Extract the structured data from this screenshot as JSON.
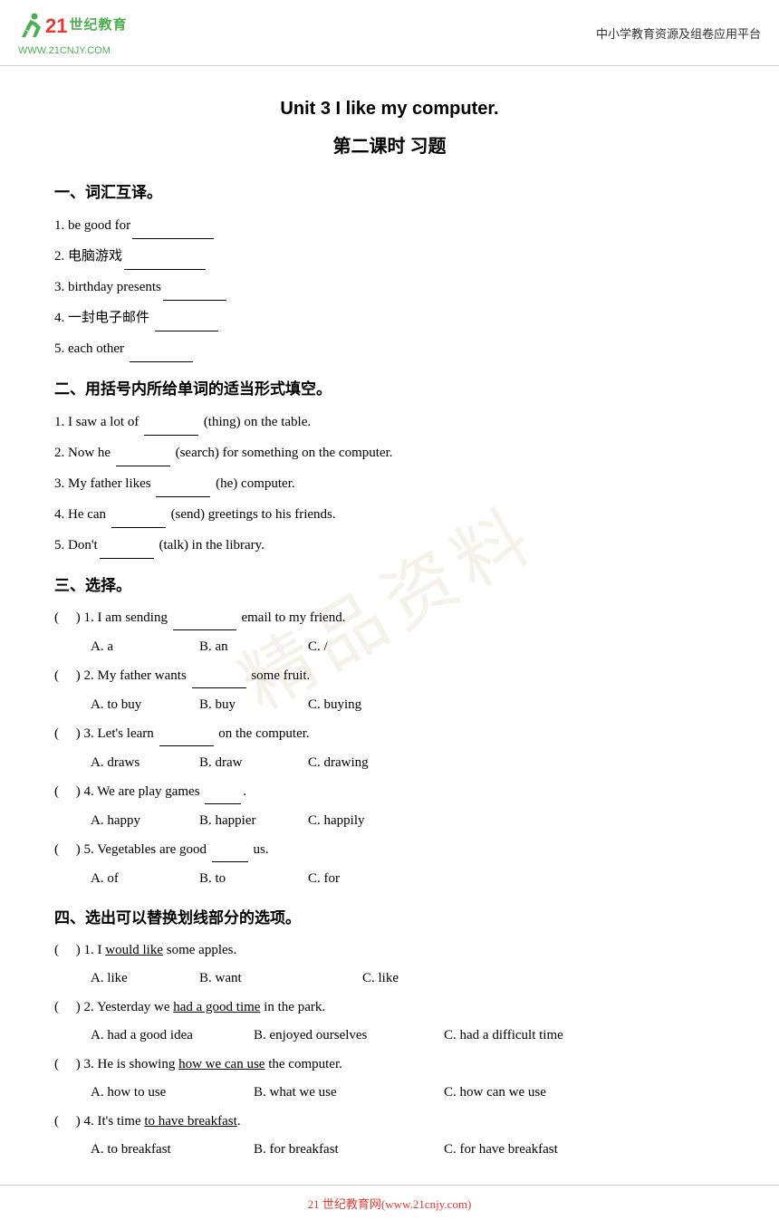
{
  "header": {
    "logo_text_21": "21",
    "logo_text_shiji": "世纪教育",
    "logo_url": "WWW.21CNJY.COM",
    "header_right": "中小学教育资源及组卷应用平台"
  },
  "main_title": "Unit 3 I like my computer.",
  "sub_title": "第二课时  习题",
  "sections": {
    "section1": {
      "title": "一、词汇互译。",
      "items": [
        "1. be good for",
        "2. 电脑游戏",
        "3. birthday presents",
        "4. 一封电子邮件",
        "5. each other"
      ]
    },
    "section2": {
      "title": "二、用括号内所给单词的适当形式填空。",
      "items": [
        "1. I saw a lot of ______ (thing) on the table.",
        "2. Now he ______ (search) for something on the computer.",
        "3. My father likes ______ (he) computer.",
        "4. He can ______ (send) greetings to his friends.",
        "5. Don't______ (talk) in the library."
      ]
    },
    "section3": {
      "title": "三、选择。",
      "items": [
        {
          "num": "1.",
          "text": "I am sending _______ email to my friend.",
          "options": [
            "A. a",
            "B. an",
            "C. /"
          ]
        },
        {
          "num": "2.",
          "text": "My father wants ______ some fruit.",
          "options": [
            "A. to buy",
            "B. buy",
            "C. buying"
          ]
        },
        {
          "num": "3.",
          "text": "Let's learn ______ on the computer.",
          "options": [
            "A. draws",
            "B. draw",
            "C. drawing"
          ]
        },
        {
          "num": "4.",
          "text": "We are play games ______.",
          "options": [
            "A. happy",
            "B. happier",
            "C. happily"
          ]
        },
        {
          "num": "5.",
          "text": "Vegetables are good ____ us.",
          "options": [
            "A. of",
            "B. to",
            "C. for"
          ]
        }
      ]
    },
    "section4": {
      "title": "四、选出可以替换划线部分的选项。",
      "items": [
        {
          "num": "1.",
          "text_before": "I ",
          "underline": "would like",
          "text_after": " some apples.",
          "options": [
            "A. like",
            "B. want",
            "C. like"
          ]
        },
        {
          "num": "2.",
          "text_before": "Yesterday we ",
          "underline": "had a good time",
          "text_after": " in the park.",
          "options": [
            "A. had a good idea",
            "B. enjoyed ourselves",
            "C. had a difficult time"
          ]
        },
        {
          "num": "3.",
          "text_before": "He is showing ",
          "underline": "how we can use",
          "text_after": " the computer.",
          "options": [
            "A. how to use",
            "B. what we use",
            "C. how can we use"
          ]
        },
        {
          "num": "4.",
          "text_before": "It's time ",
          "underline": "to have breakfast",
          "text_after": ".",
          "options": [
            "A. to breakfast",
            "B. for breakfast",
            "C. for have breakfast"
          ]
        }
      ]
    }
  },
  "footer": {
    "text": "21 世纪教育网(www.21cnjy.com)"
  },
  "watermark": "精品资料"
}
